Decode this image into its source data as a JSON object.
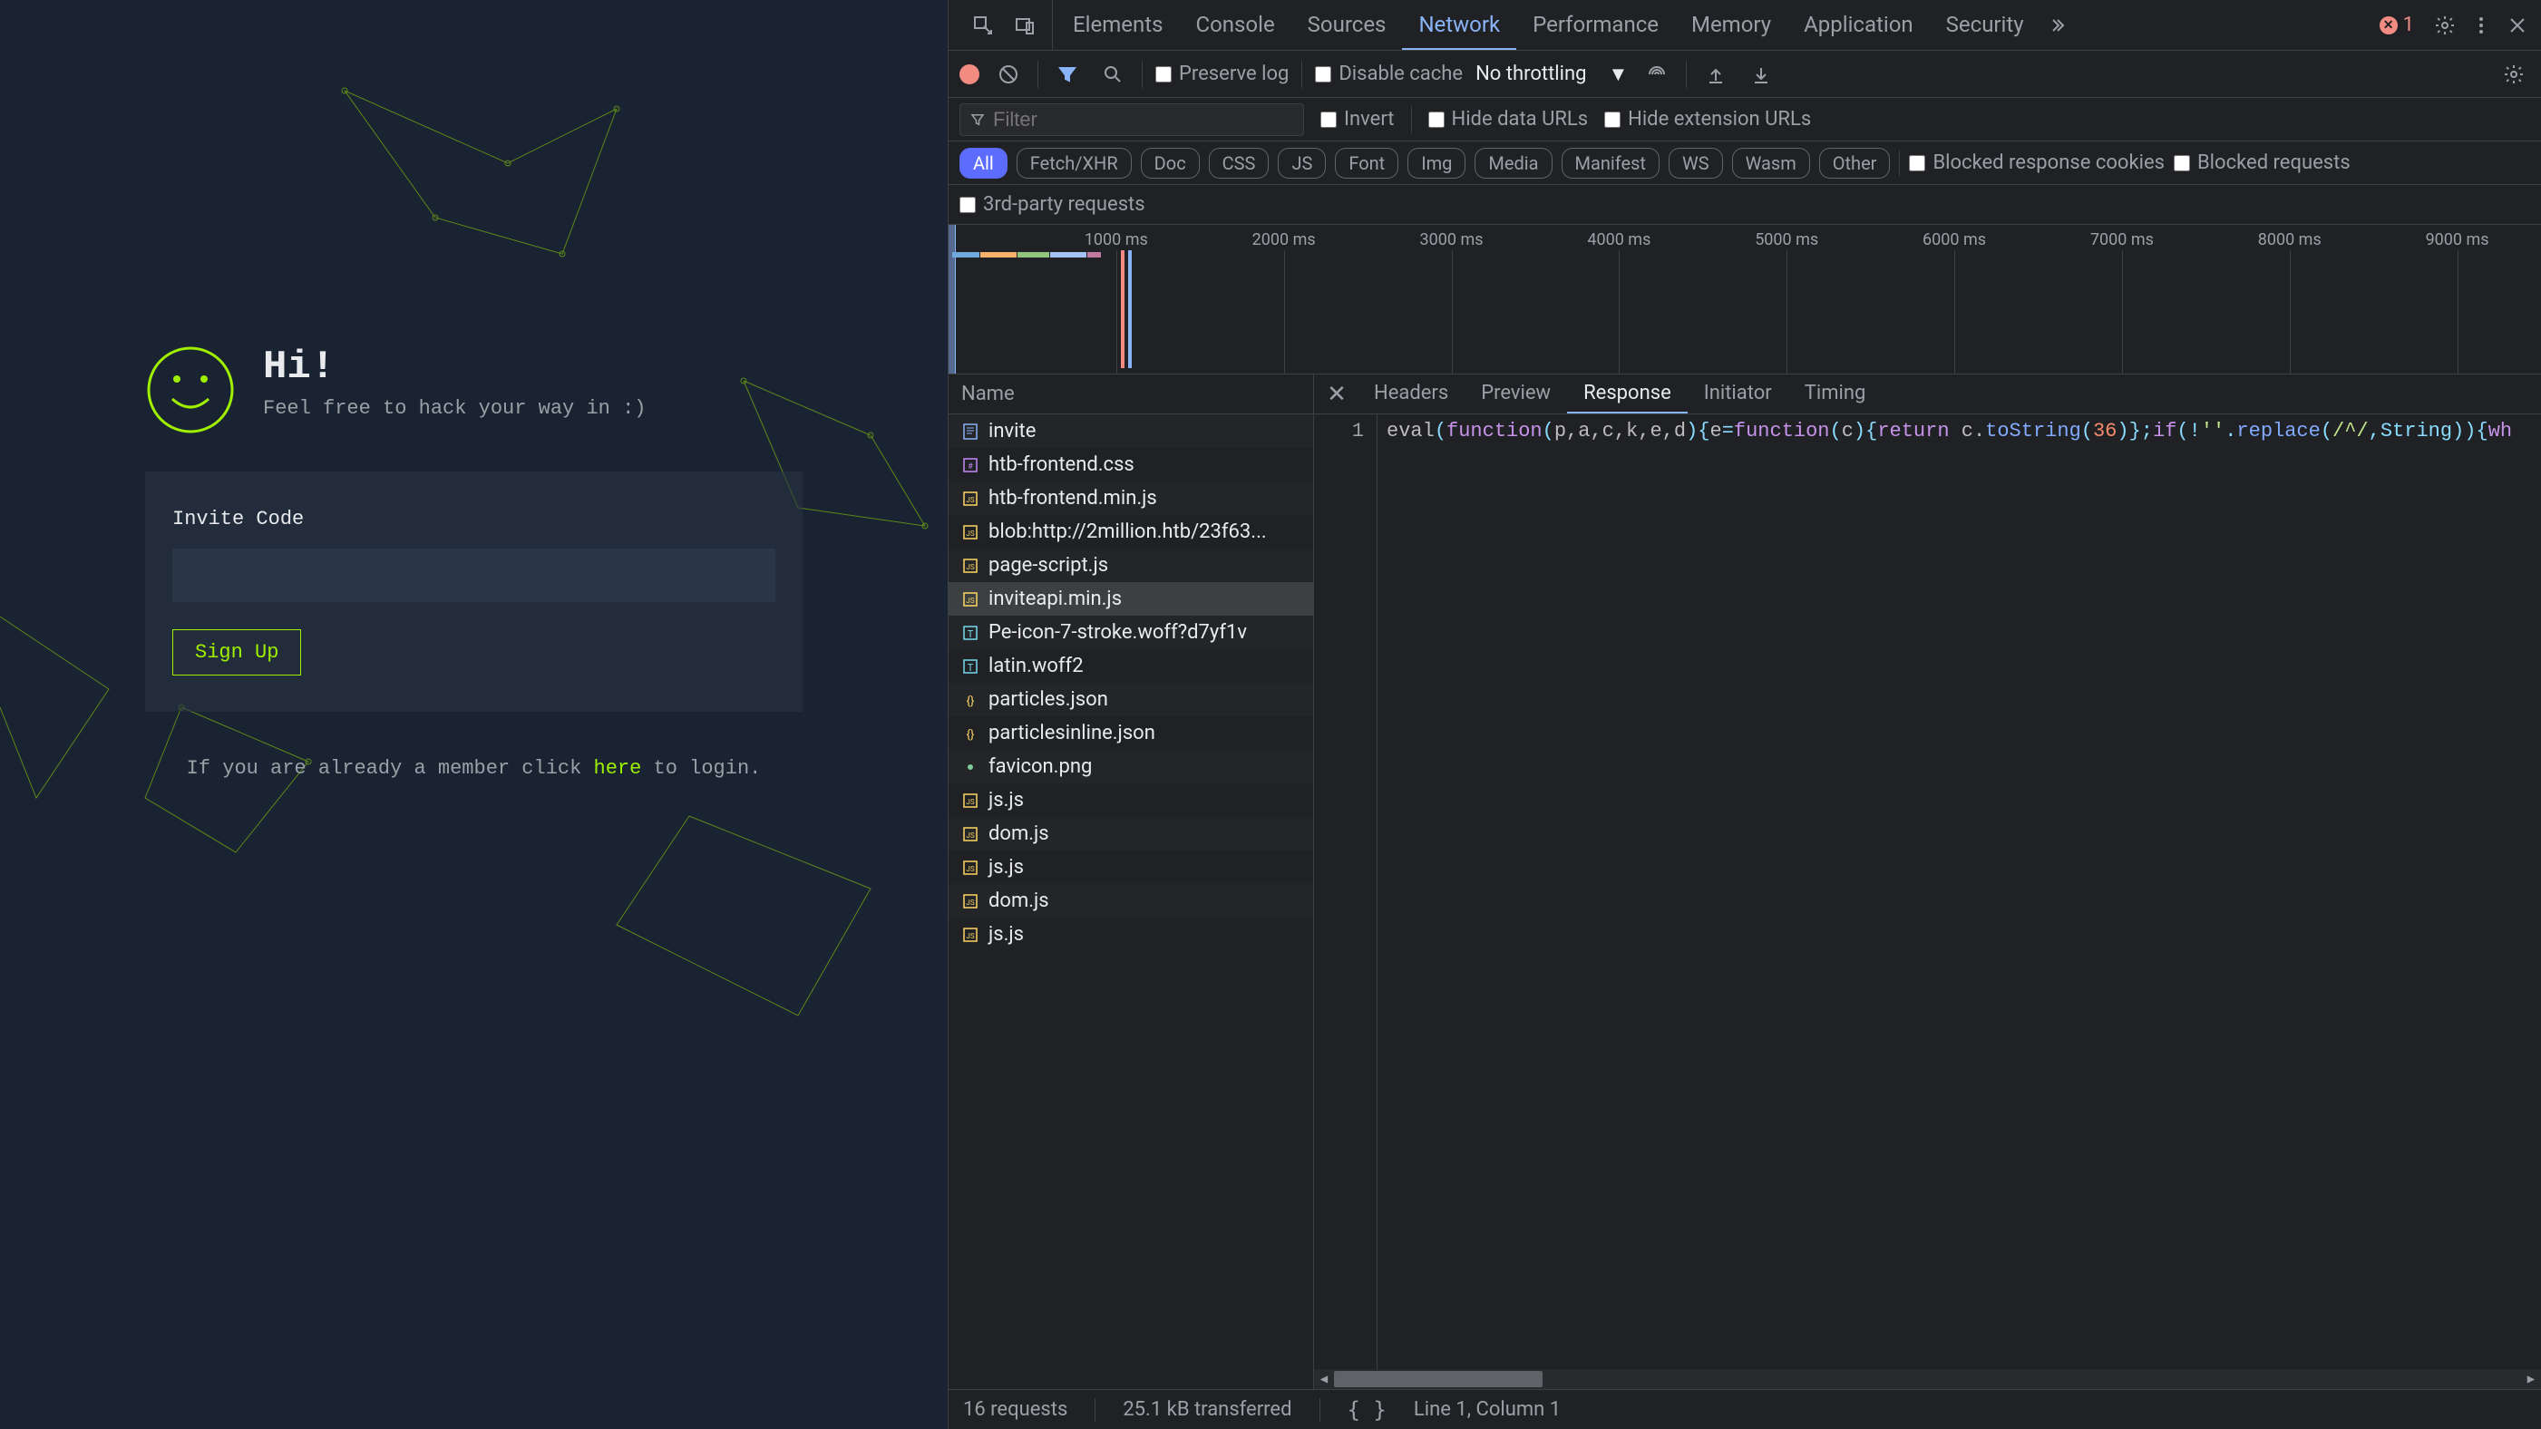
{
  "webpage": {
    "hero_title": "Hi!",
    "hero_subtitle": "Feel free to hack your way in :)",
    "invite_label": "Invite Code",
    "invite_value": "",
    "signup_label": "Sign Up",
    "login_prefix": "If you are already a member click ",
    "login_link": "here",
    "login_suffix": " to login."
  },
  "devtools": {
    "tabs": [
      "Elements",
      "Console",
      "Sources",
      "Network",
      "Performance",
      "Memory",
      "Application",
      "Security"
    ],
    "active_tab": "Network",
    "error_count": "1",
    "toolbar": {
      "preserve_log": "Preserve log",
      "disable_cache": "Disable cache",
      "throttling": "No throttling"
    },
    "filterbar": {
      "filter_placeholder": "Filter",
      "invert": "Invert",
      "hide_data_urls": "Hide data URLs",
      "hide_ext_urls": "Hide extension URLs"
    },
    "type_filters": [
      "All",
      "Fetch/XHR",
      "Doc",
      "CSS",
      "JS",
      "Font",
      "Img",
      "Media",
      "Manifest",
      "WS",
      "Wasm",
      "Other"
    ],
    "active_type": "All",
    "type_extra": {
      "blocked_cookies": "Blocked response cookies",
      "blocked_requests": "Blocked requests"
    },
    "third_party": "3rd-party requests",
    "timeline_ticks": [
      "1000 ms",
      "2000 ms",
      "3000 ms",
      "4000 ms",
      "5000 ms",
      "6000 ms",
      "7000 ms",
      "8000 ms",
      "9000 ms"
    ],
    "request_list": {
      "header": "Name",
      "items": [
        {
          "name": "invite",
          "type": "doc"
        },
        {
          "name": "htb-frontend.css",
          "type": "css"
        },
        {
          "name": "htb-frontend.min.js",
          "type": "js"
        },
        {
          "name": "blob:http://2million.htb/23f63...",
          "type": "js"
        },
        {
          "name": "page-script.js",
          "type": "js"
        },
        {
          "name": "inviteapi.min.js",
          "type": "js"
        },
        {
          "name": "Pe-icon-7-stroke.woff?d7yf1v",
          "type": "font"
        },
        {
          "name": "latin.woff2",
          "type": "font"
        },
        {
          "name": "particles.json",
          "type": "xhr"
        },
        {
          "name": "particlesinline.json",
          "type": "xhr"
        },
        {
          "name": "favicon.png",
          "type": "img"
        },
        {
          "name": "js.js",
          "type": "js"
        },
        {
          "name": "dom.js",
          "type": "js"
        },
        {
          "name": "js.js",
          "type": "js"
        },
        {
          "name": "dom.js",
          "type": "js"
        },
        {
          "name": "js.js",
          "type": "js"
        }
      ],
      "selected_index": 5
    },
    "detail_tabs": [
      "Headers",
      "Preview",
      "Response",
      "Initiator",
      "Timing"
    ],
    "active_detail_tab": "Response",
    "response": {
      "line_number": "1",
      "code_tokens": [
        {
          "t": "eval",
          "c": "id"
        },
        {
          "t": "(",
          "c": "op"
        },
        {
          "t": "function",
          "c": "kw"
        },
        {
          "t": "(",
          "c": "op"
        },
        {
          "t": "p,a,c,k,e,d",
          "c": "id"
        },
        {
          "t": "){",
          "c": "op"
        },
        {
          "t": "e",
          "c": "id"
        },
        {
          "t": "=",
          "c": "op"
        },
        {
          "t": "function",
          "c": "kw"
        },
        {
          "t": "(",
          "c": "op"
        },
        {
          "t": "c",
          "c": "id"
        },
        {
          "t": "){",
          "c": "op"
        },
        {
          "t": "return",
          "c": "kw"
        },
        {
          "t": " c.",
          "c": "id"
        },
        {
          "t": "toString",
          "c": "fn"
        },
        {
          "t": "(",
          "c": "op"
        },
        {
          "t": "36",
          "c": "num"
        },
        {
          "t": ")};",
          "c": "op"
        },
        {
          "t": "if",
          "c": "kw"
        },
        {
          "t": "(!",
          "c": "op"
        },
        {
          "t": "''",
          "c": "str"
        },
        {
          "t": ".",
          "c": "op"
        },
        {
          "t": "replace",
          "c": "fn"
        },
        {
          "t": "(",
          "c": "op"
        },
        {
          "t": "/^/",
          "c": "str"
        },
        {
          "t": ",String)){",
          "c": "op"
        },
        {
          "t": "wh",
          "c": "kw"
        }
      ]
    },
    "status": {
      "requests": "16 requests",
      "transferred": "25.1 kB transferred",
      "cursor": "Line 1, Column 1"
    }
  }
}
